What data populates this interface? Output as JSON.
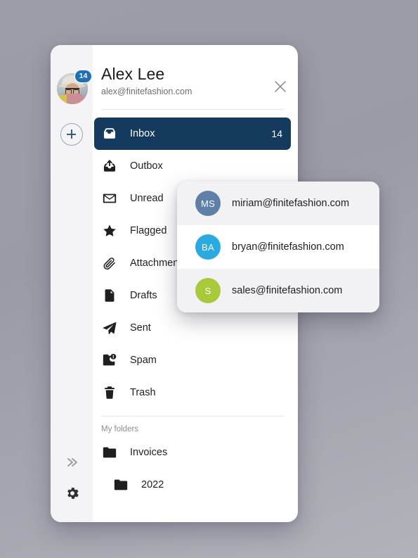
{
  "background": {
    "color_top": "#9b9ba6",
    "color_bottom": "#b2b2bb"
  },
  "panel": {
    "accent_active": "#143a5e",
    "badge_color": "#1f6fb8"
  },
  "rail": {
    "avatar_badge_count": "14",
    "avatar_name": "avatar",
    "add_account_label": "+",
    "expand_icon": "double-chevron-right-icon",
    "settings_icon": "gear-icon"
  },
  "account_header": {
    "name": "Alex Lee",
    "email": "alex@finitefashion.com",
    "close_icon": "close-icon"
  },
  "nav": {
    "items": [
      {
        "label": "Inbox",
        "icon": "inbox-icon",
        "count": "14",
        "active": true
      },
      {
        "label": "Outbox",
        "icon": "outbox-icon",
        "count": "",
        "active": false
      },
      {
        "label": "Unread",
        "icon": "envelope-icon",
        "count": "",
        "active": false
      },
      {
        "label": "Flagged",
        "icon": "star-icon",
        "count": "",
        "active": false
      },
      {
        "label": "Attachments",
        "icon": "paperclip-icon",
        "count": "",
        "active": false
      },
      {
        "label": "Drafts",
        "icon": "document-icon",
        "count": "",
        "active": false
      },
      {
        "label": "Sent",
        "icon": "paper-plane-icon",
        "count": "",
        "active": false
      },
      {
        "label": "Spam",
        "icon": "spam-folder-icon",
        "count": "",
        "active": false
      },
      {
        "label": "Trash",
        "icon": "trash-icon",
        "count": "",
        "active": false
      }
    ]
  },
  "folders": {
    "title": "My folders",
    "items": [
      {
        "label": "Invoices",
        "icon": "folder-icon",
        "nested": false
      },
      {
        "label": "2022",
        "icon": "folder-icon",
        "nested": true
      }
    ]
  },
  "account_popup": {
    "rows": [
      {
        "initials": "MS",
        "email": "miriam@finitefashion.com",
        "color": "#5d7fa8",
        "highlighted": false
      },
      {
        "initials": "BA",
        "email": "bryan@finitefashion.com",
        "color": "#29abe2",
        "highlighted": true
      },
      {
        "initials": "S",
        "email": "sales@finitefashion.com",
        "color": "#a8c93a",
        "highlighted": false
      }
    ]
  }
}
